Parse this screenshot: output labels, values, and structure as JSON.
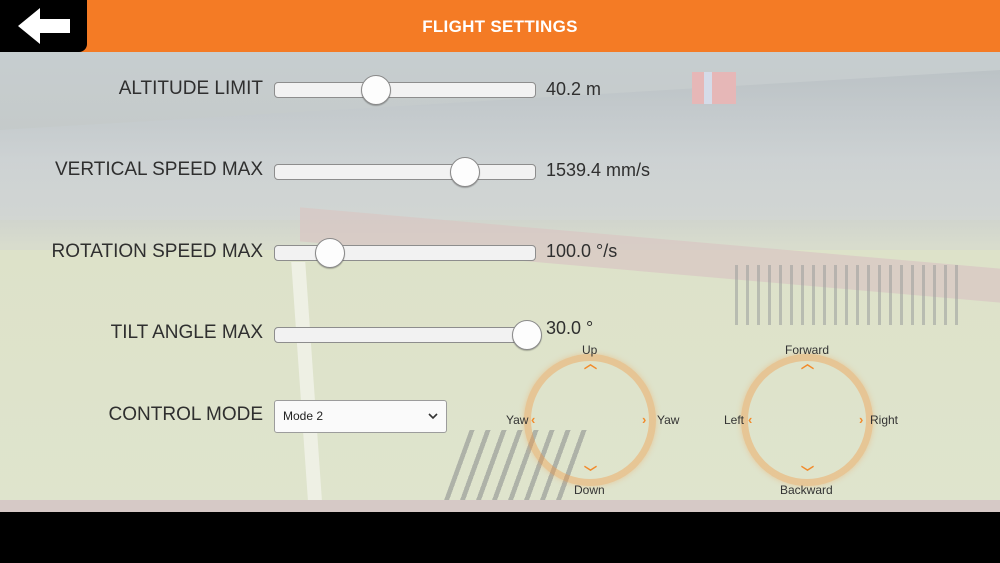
{
  "header": {
    "title": "FLIGHT SETTINGS",
    "back_icon": "arrow-left-icon"
  },
  "settings": [
    {
      "label": "ALTITUDE LIMIT",
      "value_text": "40.2 m",
      "position_fraction": 0.39
    },
    {
      "label": "VERTICAL SPEED  MAX",
      "value_text": "1539.4 mm/s",
      "position_fraction": 0.73
    },
    {
      "label": "ROTATION SPEED MAX",
      "value_text": "100.0 °/s",
      "position_fraction": 0.21
    },
    {
      "label": "TILT ANGLE MAX",
      "value_text": "30.0 °",
      "position_fraction": 1.0
    }
  ],
  "control_mode": {
    "label": "CONTROL MODE",
    "selected": "Mode 2"
  },
  "left_stick": {
    "up": "Up",
    "down": "Down",
    "left": "Yaw",
    "right": "Yaw"
  },
  "right_stick": {
    "up": "Forward",
    "down": "Backward",
    "left": "Left",
    "right": "Right"
  },
  "colors": {
    "accent": "#f47b25",
    "stick_arrow": "#f28a2a"
  }
}
